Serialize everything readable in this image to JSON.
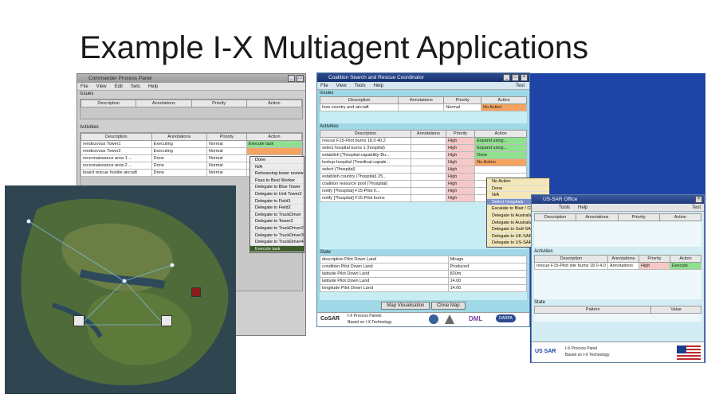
{
  "slide": {
    "title": "Example I-X Multiagent Applications"
  },
  "commander": {
    "title": "Commander Process Panel",
    "menu": [
      "File",
      "View",
      "Edit",
      "Sets",
      "Help"
    ],
    "issues_label": "Issues",
    "issues_headers": [
      "Description",
      "Annotations",
      "Priority",
      "Action"
    ],
    "activities_label": "Activities",
    "activity_headers": [
      "Description",
      "Annotations",
      "Priority",
      "Action"
    ],
    "activities": [
      [
        "rendezvous Tower1",
        "Executing",
        "Normal",
        "Execute task"
      ],
      [
        "rendezvous Tower2",
        "Executing",
        "Normal",
        ""
      ],
      [
        "reconnaissance area 1 ...",
        "Done",
        "Normal",
        ""
      ],
      [
        "reconnaissance area 2 ...",
        "Done",
        "Normal",
        ""
      ],
      [
        "board rescue hostile aircraft",
        "Done",
        "Normal",
        ""
      ]
    ],
    "action_menu": [
      "Done",
      "N/A",
      "Rehearsing tower review",
      "Pass to Best Worker",
      "Delegate to Blue Tower",
      "Delegate to Unit Tower2",
      "Delegate to Field1",
      "Delegate to Field2",
      "Delegate to TruckDriver",
      "Delegate to Tower3",
      "Delegate to TruckDriver2",
      "Delegate to TruckDriver3",
      "Delegate to TruckDriver4",
      "Execute task"
    ]
  },
  "coalition": {
    "title": "Coalition Search and Rescue Coordinator",
    "menu": [
      "File",
      "View",
      "Tools",
      "Help"
    ],
    "menu_right": "Test",
    "issues_label": "Issues",
    "issues_headers": [
      "Description",
      "Annotations",
      "Priority",
      "Action"
    ],
    "issues": [
      [
        "how country and aircraft",
        "",
        "Normal",
        "No Action"
      ]
    ],
    "activities_label": "Activities",
    "activity_headers": [
      "Description",
      "Annotations",
      "Priority",
      "Action"
    ],
    "activities": [
      [
        "rescue F15-Pilot burns 18.0 40.2",
        "",
        "High",
        "Expand using..."
      ],
      [
        "select hospital burns 1 (hospital)",
        "",
        "High",
        "Expand using..."
      ],
      [
        "establish [?hospital-capability-Bu...",
        "",
        "High",
        "Done"
      ],
      [
        "lookup-hospital (?medical-capabi...",
        "",
        "High",
        "No Action"
      ],
      [
        "select (?hospital)",
        "",
        "High",
        ""
      ],
      [
        "establish country (?hospital) 25...",
        "",
        "High",
        ""
      ],
      [
        "coalition resource pool (?hospital)",
        "",
        "High",
        ""
      ],
      [
        "notify [?hospital] F15-Pilot II...",
        "",
        "High",
        ""
      ],
      [
        "notify [?hospital] F15-Pilot burns",
        "",
        "High",
        ""
      ]
    ],
    "action_menu": [
      "No Action",
      "Done",
      "N/A",
      "Select Hospitals",
      "Escalate to Blair / CFB",
      "Delegate to Australia-SAR",
      "Delegate to Australia-SAR",
      "Delegate to Gulf-SAR",
      "Delegate to UK-SAR",
      "Delegate to US-SAR"
    ],
    "state_label": "State",
    "state_rows": [
      [
        "description Pilot Down Land",
        "Mirage"
      ],
      [
        "condition Pilot Down Land",
        "Produced"
      ],
      [
        "latitude Pilot Down Land",
        "820m"
      ],
      [
        "latitude Pilot Down Land",
        "14.00"
      ],
      [
        "longitude Pilot Down Land",
        "14.00"
      ]
    ],
    "buttons": [
      "Map Visualisation",
      "Close Map"
    ],
    "footer_logo": "CoSAR",
    "footer_text1": "I-X Process Panels",
    "footer_text2": "Based on I-X Technology",
    "logos": [
      "DARPA",
      "DML"
    ]
  },
  "ussar": {
    "title": "US-SAR Office",
    "menu": [
      "Tools",
      "Help"
    ],
    "menu_right": "Test",
    "issue_headers": [
      "Description",
      "Annotations",
      "Priority",
      "Action"
    ],
    "activities_label": "Activities",
    "activity_headers": [
      "Description",
      "Annotations",
      "Priority",
      "Action"
    ],
    "activities": [
      [
        "rescue F15-Pilot site burns 18.0 4.0",
        "Annotations",
        "High",
        "Execute"
      ]
    ],
    "state_label": "State",
    "state_headers": [
      "Pattern",
      "Value"
    ],
    "footer_logo": "US SAR",
    "footer_text1": "I-X Process Panel",
    "footer_text2": "Based on I-X Technology"
  },
  "colors": {
    "accent_blue": "#1e44a8",
    "priority_high": "#f6c9c9",
    "execute_green": "#8fe08f",
    "no_action_orange": "#f4a460"
  }
}
